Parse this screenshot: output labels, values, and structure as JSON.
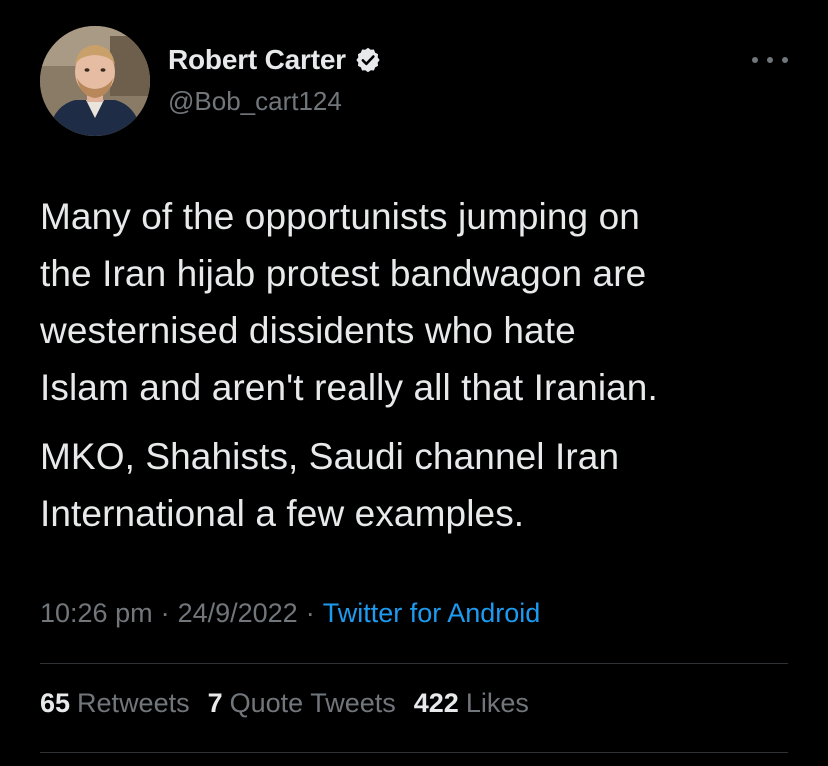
{
  "author": {
    "display_name": "Robert Carter",
    "handle": "@Bob_cart124",
    "verified": true
  },
  "icons": {
    "verified": "verified-badge-icon",
    "more": "more-options-icon"
  },
  "tweet": {
    "paragraphs": [
      "Many of the opportunists jumping on\nthe Iran hijab protest bandwagon are\nwesternised dissidents who hate\nIslam and aren't really all that Iranian.",
      "MKO, Shahists, Saudi channel Iran\nInternational a few examples."
    ]
  },
  "meta": {
    "time": "10:26 pm",
    "separator": "·",
    "date": "24/9/2022",
    "source": "Twitter for Android"
  },
  "stats": {
    "retweets_count": "65",
    "retweets_label": "Retweets",
    "quotes_count": "7",
    "quotes_label": "Quote Tweets",
    "likes_count": "422",
    "likes_label": "Likes"
  },
  "colors": {
    "background": "#000000",
    "text_primary": "#e7e9ea",
    "text_secondary": "#71767b",
    "link": "#1d9bf0",
    "divider": "#2f3336"
  }
}
